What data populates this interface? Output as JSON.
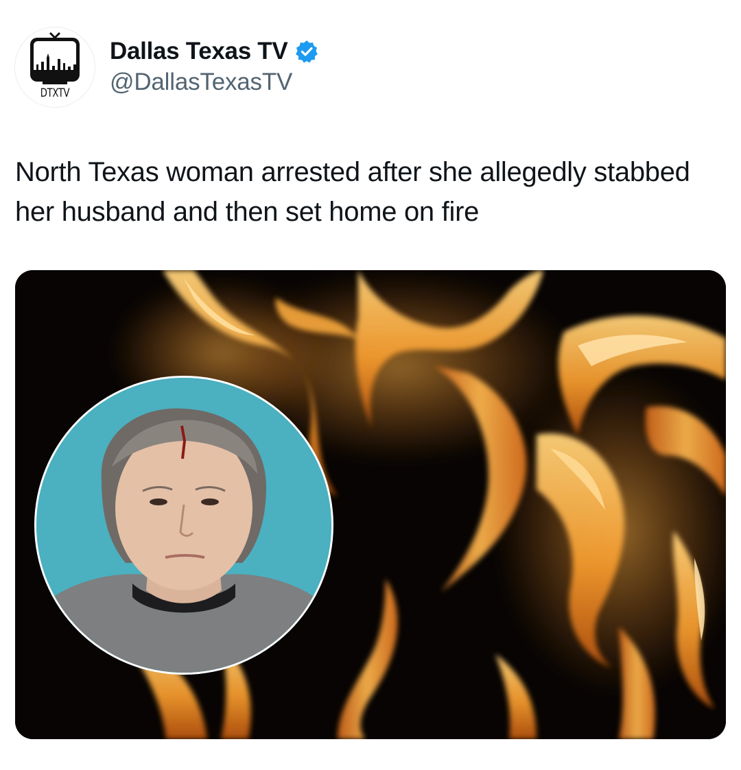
{
  "account": {
    "display_name": "Dallas Texas TV",
    "handle": "@DallasTexasTV",
    "avatar_text": "DTXTV",
    "verified": true,
    "verified_color": "#1d9bf0"
  },
  "post": {
    "text": "North Texas woman arrested after she allegedly stabbed her husband and then set home on fire"
  },
  "media": {
    "background": "flames",
    "inset": "mugshot-portrait",
    "flame_colors": [
      "#f7b54a",
      "#e07a1c",
      "#ffd98a"
    ]
  },
  "colors": {
    "text": "#0f1419",
    "secondary": "#536471",
    "inset_background": "#4bb0c0"
  }
}
